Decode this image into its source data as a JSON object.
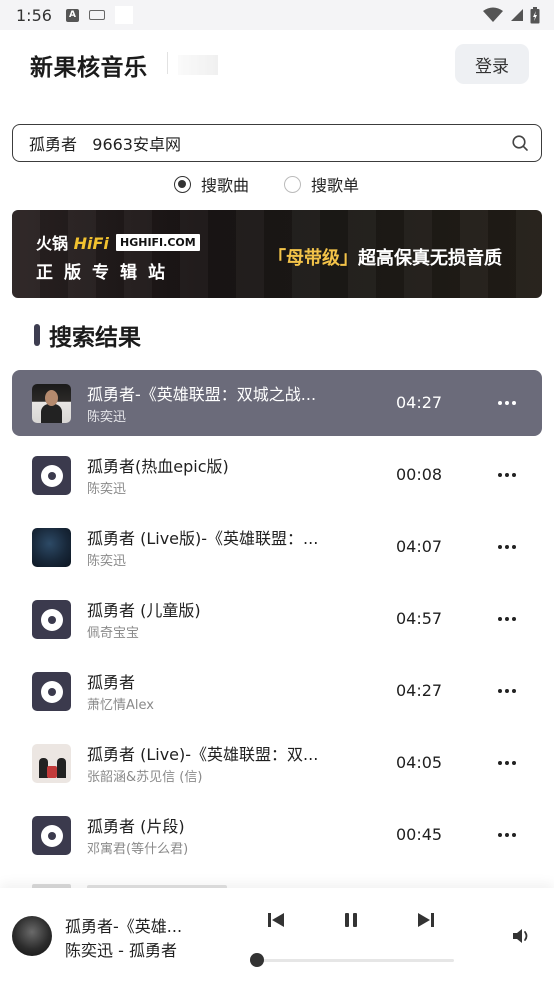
{
  "status_bar": {
    "time": "1:56"
  },
  "header": {
    "app_title": "新果核音乐",
    "login_label": "登录"
  },
  "search": {
    "value": "孤勇者   9663安卓网"
  },
  "search_type": {
    "options": [
      {
        "label": "搜歌曲",
        "selected": true
      },
      {
        "label": "搜歌单",
        "selected": false
      }
    ]
  },
  "banner": {
    "brand_cn": "火锅",
    "brand_hifi": "HiFi",
    "tag": "HGHIFI.COM",
    "subtitle": "正版专辑站",
    "slogan_gold": "「母带级」",
    "slogan_rest": "超高保真无损音质"
  },
  "section": {
    "title": "搜索结果"
  },
  "songs": [
    {
      "title": "孤勇者-《英雄联盟：双城之战...",
      "artist": "陈奕迅",
      "duration": "04:27",
      "cover": "photo-cover",
      "active": true
    },
    {
      "title": "孤勇者(热血epic版)",
      "artist": "陈奕迅",
      "duration": "00:08",
      "cover": "disc-icon",
      "active": false
    },
    {
      "title": "孤勇者 (Live版)-《英雄联盟：...",
      "artist": "陈奕迅",
      "duration": "04:07",
      "cover": "photo-cover",
      "active": false
    },
    {
      "title": "孤勇者 (儿童版)",
      "artist": "佩奇宝宝",
      "duration": "04:57",
      "cover": "disc-icon",
      "active": false
    },
    {
      "title": "孤勇者",
      "artist": "萧忆情Alex",
      "duration": "04:27",
      "cover": "disc-icon",
      "active": false
    },
    {
      "title": "孤勇者 (Live)-《英雄联盟：双...",
      "artist": "张韶涵&苏见信 (信)",
      "duration": "04:05",
      "cover": "photo-cover",
      "active": false
    },
    {
      "title": "孤勇者 (片段)",
      "artist": "邓寓君(等什么君)",
      "duration": "00:45",
      "cover": "disc-icon",
      "active": false
    }
  ],
  "player": {
    "title": "孤勇者-《英雄...",
    "artist_line": "陈奕迅 - 孤勇者",
    "progress": 0.0,
    "colors": {
      "accent": "#6b6b7a",
      "disc": "#3b3a4d"
    }
  }
}
